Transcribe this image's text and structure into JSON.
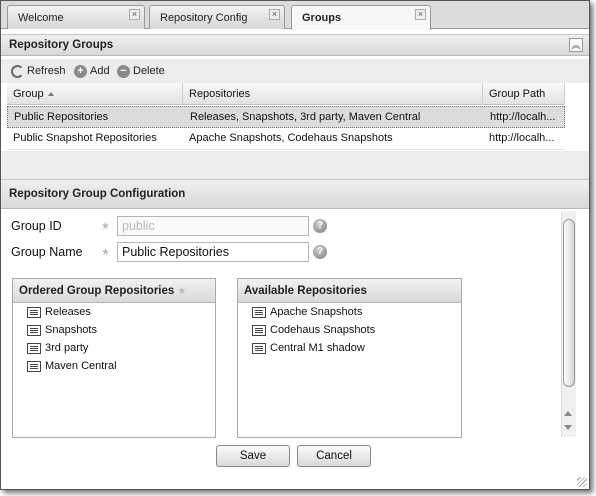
{
  "tabs": [
    {
      "label": "Welcome",
      "close": "×"
    },
    {
      "label": "Repository Config",
      "close": "×"
    },
    {
      "label": "Groups",
      "close": "×"
    }
  ],
  "groups_panel": {
    "title": "Repository Groups",
    "collapse_icon": "︽",
    "toolbar": {
      "refresh": "Refresh",
      "add": "Add",
      "delete": "Delete"
    },
    "columns": [
      "Group",
      "Repositories",
      "Group Path"
    ],
    "rows": [
      {
        "group": "Public Repositories",
        "repositories": "Releases, Snapshots, 3rd party, Maven Central",
        "path": "http://localh..."
      },
      {
        "group": "Public Snapshot Repositories",
        "repositories": "Apache Snapshots, Codehaus Snapshots",
        "path": "http://localh..."
      }
    ]
  },
  "config_panel": {
    "title": "Repository Group Configuration",
    "group_id": {
      "label": "Group ID",
      "value": "public",
      "star": "★",
      "help": "?"
    },
    "group_name": {
      "label": "Group Name",
      "value": "Public Repositories",
      "star": "★",
      "help": "?"
    },
    "ordered": {
      "title": "Ordered Group Repositories",
      "star": "★",
      "items": [
        "Releases",
        "Snapshots",
        "3rd party",
        "Maven Central"
      ]
    },
    "available": {
      "title": "Available Repositories",
      "items": [
        "Apache Snapshots",
        "Codehaus Snapshots",
        "Central M1 shadow"
      ]
    },
    "save": "Save",
    "cancel": "Cancel"
  },
  "icons": {
    "refresh": "refresh-icon",
    "add": "add-icon",
    "delete": "delete-icon",
    "help": "help-icon",
    "repo": "repository-icon"
  }
}
